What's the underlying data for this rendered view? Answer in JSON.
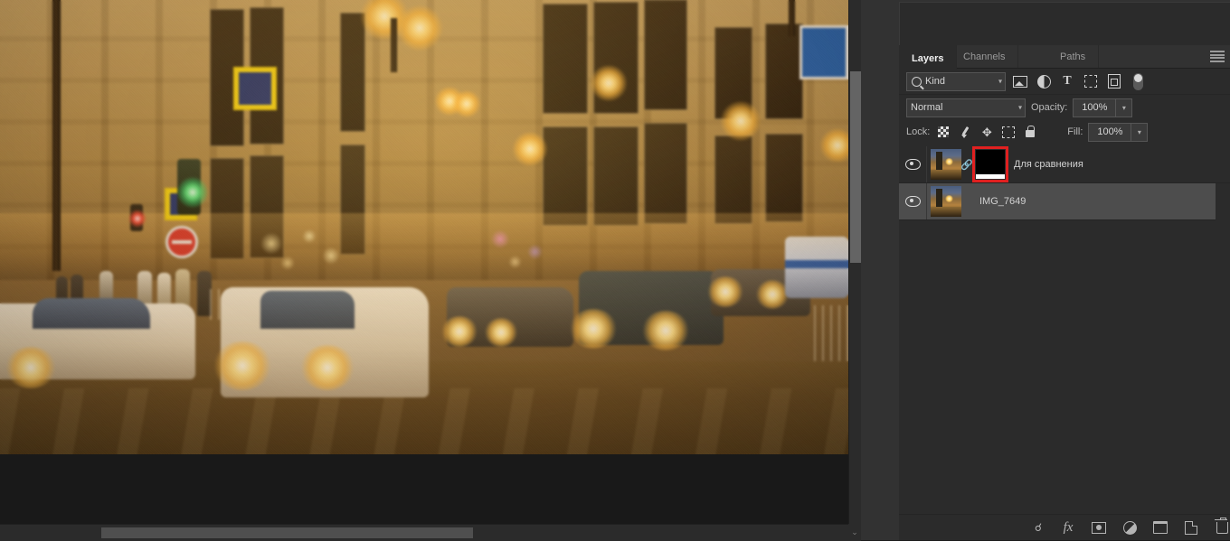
{
  "canvas": {
    "image_description": "Night city street scene with illuminated building facade, traffic lights, pedestrian crossing signs and cars with headlights",
    "scrollbar_horizontal": "horizontal-scrollbar",
    "scrollbar_vertical": "vertical-scrollbar"
  },
  "panel": {
    "tabs": [
      {
        "label": "Layers",
        "active": true
      },
      {
        "label": "Channels",
        "active": false
      },
      {
        "label": "Paths",
        "active": false
      }
    ],
    "menu_icon": "panel-menu-icon",
    "filter": {
      "kind_label": "Kind",
      "icons": [
        "pixel-layer-filter-icon",
        "adjustment-layer-filter-icon",
        "type-layer-filter-icon",
        "shape-layer-filter-icon",
        "smart-object-filter-icon"
      ],
      "toggle": "filter-enable-toggle"
    },
    "blend": {
      "mode": "Normal",
      "opacity_label": "Opacity:",
      "opacity_value": "100%"
    },
    "lock": {
      "label": "Lock:",
      "icons": [
        "lock-transparency-icon",
        "lock-image-icon",
        "lock-position-icon",
        "lock-artboard-icon",
        "lock-all-icon"
      ],
      "fill_label": "Fill:",
      "fill_value": "100%"
    },
    "layers": [
      {
        "name": "Для сравнения",
        "visible": true,
        "selected": false,
        "has_mask": true,
        "mask_selected": true,
        "linked": true
      },
      {
        "name": "IMG_7649",
        "visible": true,
        "selected": true,
        "has_mask": false,
        "mask_selected": false,
        "linked": false
      }
    ],
    "bottom_buttons": [
      "link-layers-button",
      "layer-style-fx-button",
      "add-layer-mask-button",
      "new-adjustment-layer-button",
      "new-group-button",
      "new-layer-button",
      "delete-layer-button"
    ]
  },
  "colors": {
    "panel_bg": "#2b2b2b",
    "dock_bg": "#323232",
    "selected_row": "#4d4d4d",
    "mask_highlight": "#e02020",
    "text": "#c8c8c8"
  }
}
